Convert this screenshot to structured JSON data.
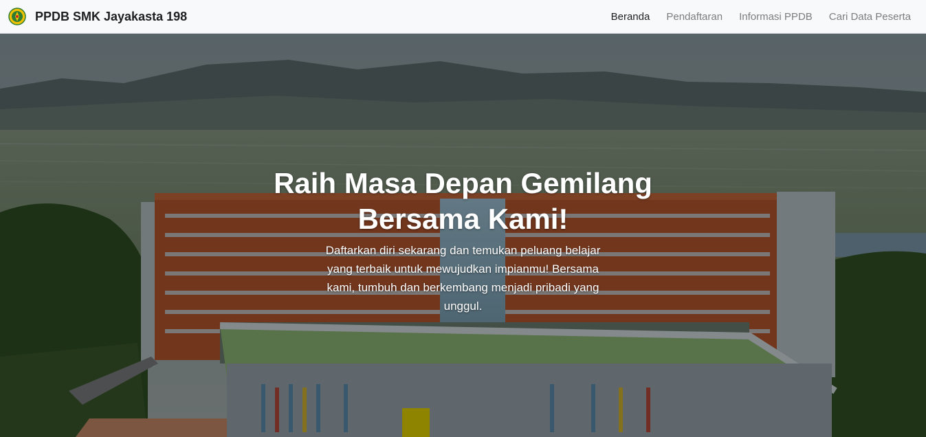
{
  "navbar": {
    "brand": {
      "logo_icon": "school-emblem-icon",
      "title": "PPDB SMK Jayakasta 198"
    },
    "links": [
      {
        "label": "Beranda",
        "active": true
      },
      {
        "label": "Pendaftaran",
        "active": false
      },
      {
        "label": "Informasi PPDB",
        "active": false
      },
      {
        "label": "Cari Data Peserta",
        "active": false
      }
    ]
  },
  "hero": {
    "background": "campus-building-photo",
    "title": "Raih Masa Depan Gemilang Bersama Kami!",
    "description": "Daftarkan diri sekarang dan temukan peluang belajar yang terbaik untuk mewujudkan impianmu! Bersama kami, tumbuh dan berkembang menjadi pribadi yang unggul."
  },
  "colors": {
    "navbar_bg": "#f8f9fa",
    "nav_active": "#1f1f1f",
    "nav_inactive": "#7a7e82",
    "hero_text": "#ffffff"
  }
}
